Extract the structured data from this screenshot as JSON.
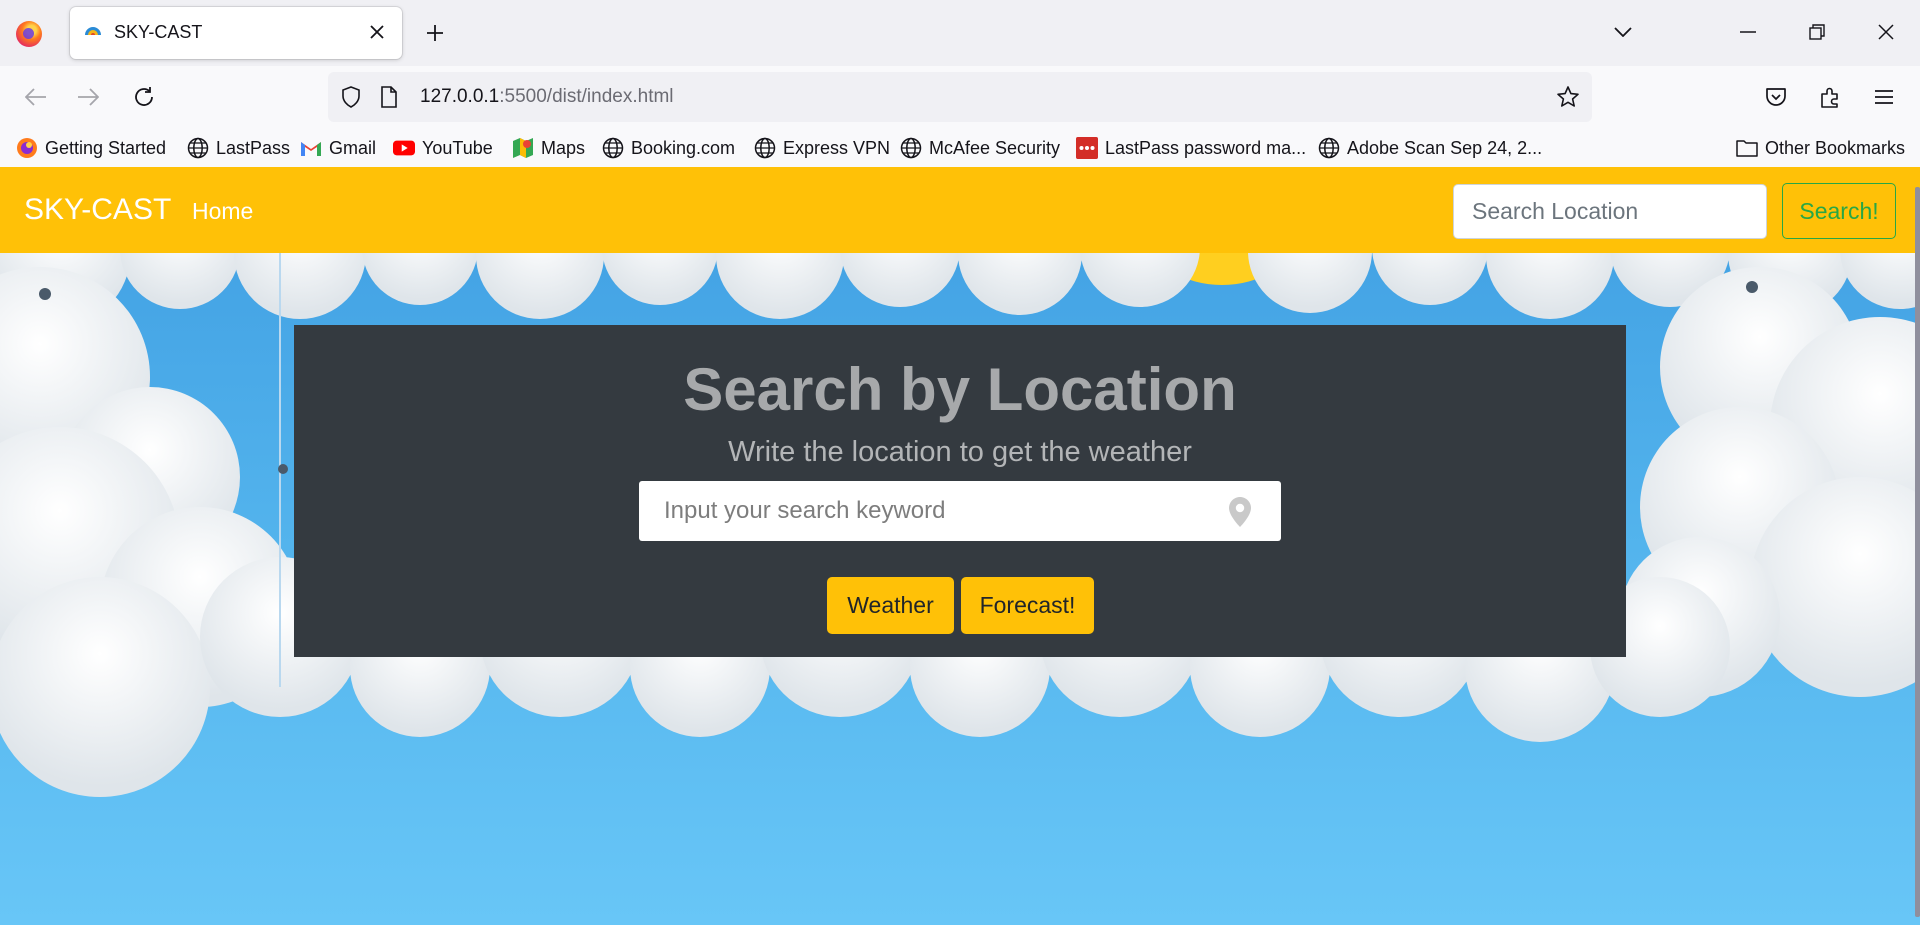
{
  "browser": {
    "tab": {
      "title": "SKY-CAST"
    },
    "url": {
      "host": "127.0.0.1",
      "path": ":5500/dist/index.html"
    },
    "bookmarks": [
      {
        "label": "Getting Started",
        "icon": "firefox-icon"
      },
      {
        "label": "LastPass",
        "icon": "globe-icon"
      },
      {
        "label": "Gmail",
        "icon": "gmail-icon"
      },
      {
        "label": "YouTube",
        "icon": "youtube-icon"
      },
      {
        "label": "Maps",
        "icon": "maps-icon"
      },
      {
        "label": "Booking.com",
        "icon": "globe-icon"
      },
      {
        "label": "Express VPN",
        "icon": "globe-icon"
      },
      {
        "label": "McAfee Security",
        "icon": "globe-icon"
      },
      {
        "label": "LastPass password ma...",
        "icon": "lastpass-icon"
      },
      {
        "label": "Adobe Scan Sep 24, 2...",
        "icon": "globe-icon"
      }
    ],
    "other_bookmarks": "Other Bookmarks"
  },
  "site": {
    "brand": "SKY-CAST",
    "nav_home": "Home",
    "search_placeholder": "Search Location",
    "search_button": "Search!",
    "accent_color": "#ffc107",
    "panel": {
      "title": "Search by Location",
      "subtitle": "Write the location to get the weather",
      "input_placeholder": "Input your search keyword",
      "weather_button": "Weather",
      "forecast_button": "Forecast!"
    }
  }
}
